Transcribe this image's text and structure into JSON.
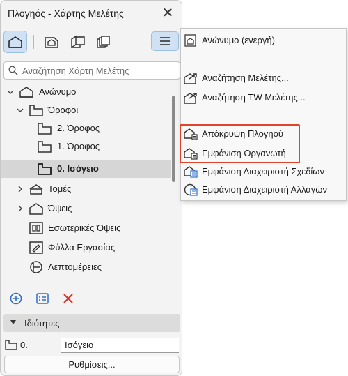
{
  "window": {
    "title": "Πλογηός - Χάρτης Μελέτης",
    "close_symbol": "✕"
  },
  "toolbar": {
    "buttons": [
      {
        "icon": "project-map-icon",
        "active": true
      },
      {
        "icon": "view-map-icon",
        "active": false
      },
      {
        "icon": "layout-book-icon",
        "active": false
      },
      {
        "icon": "publisher-sets-icon",
        "active": false
      }
    ],
    "menu_icon": "hamburger-menu-icon"
  },
  "search": {
    "placeholder": "Αναζήτηση Χάρτη Μελέτης",
    "value": ""
  },
  "tree": [
    {
      "label": "Ανώνυμο",
      "icon": "project-house-icon",
      "level": 0,
      "arrow": "expanded"
    },
    {
      "label": "Όροφοι",
      "icon": "stories-icon",
      "level": 1,
      "arrow": "expanded"
    },
    {
      "label": "2. Όροφος",
      "icon": "story-icon",
      "level": 2,
      "arrow": "none"
    },
    {
      "label": "1. Όροφος",
      "icon": "story-icon",
      "level": 2,
      "arrow": "none"
    },
    {
      "label": "0. Ισόγειο",
      "icon": "story-icon",
      "level": 2,
      "arrow": "none",
      "selected": true,
      "bold": true
    },
    {
      "label": "Τομές",
      "icon": "section-icon",
      "level": 1,
      "arrow": "collapsed"
    },
    {
      "label": "Όψεις",
      "icon": "elevation-icon",
      "level": 1,
      "arrow": "collapsed"
    },
    {
      "label": "Εσωτερικές Όψεις",
      "icon": "interior-elevation-icon",
      "level": 1,
      "arrow": "none"
    },
    {
      "label": "Φύλλα Εργασίας",
      "icon": "worksheet-icon",
      "level": 1,
      "arrow": "none"
    },
    {
      "label": "Λεπτομέρειες",
      "icon": "detail-icon",
      "level": 1,
      "arrow": "none"
    }
  ],
  "bottom_tools": [
    {
      "icon": "add-icon"
    },
    {
      "icon": "settings-list-icon"
    },
    {
      "icon": "delete-icon"
    }
  ],
  "properties": {
    "header": "Ιδιότητες",
    "number": "0.",
    "name_value": "Ισόγειο",
    "settings_label": "Ρυθμίσεις..."
  },
  "menu": {
    "items": [
      {
        "label": "Ανώνυμο (ενεργή)",
        "icon": "active-project-icon"
      },
      {
        "label": "Αναζήτηση Μελέτης...",
        "icon": "browse-project-icon"
      },
      {
        "label": "Αναζήτηση TW Μελέτης...",
        "icon": "browse-teamwork-project-icon"
      },
      {
        "label": "Απόκρυψη Πλογηού",
        "icon": "hide-navigator-icon",
        "highlighted": true
      },
      {
        "label": "Εμφάνιση Οργανωτή",
        "icon": "show-organizer-icon",
        "highlighted": true
      },
      {
        "label": "Εμφάνιση Διαχειριστή Σχεδίων",
        "icon": "drawing-manager-icon"
      },
      {
        "label": "Εμφάνιση Διαχειριστή Αλλαγών",
        "icon": "change-manager-icon"
      }
    ]
  },
  "colors": {
    "accent_blue": "#2f6fc4",
    "selected_row": "#d6d6d6",
    "active_button": "#cfe1f3",
    "highlight_red": "#e0452b",
    "delete_red": "#d9362b"
  }
}
